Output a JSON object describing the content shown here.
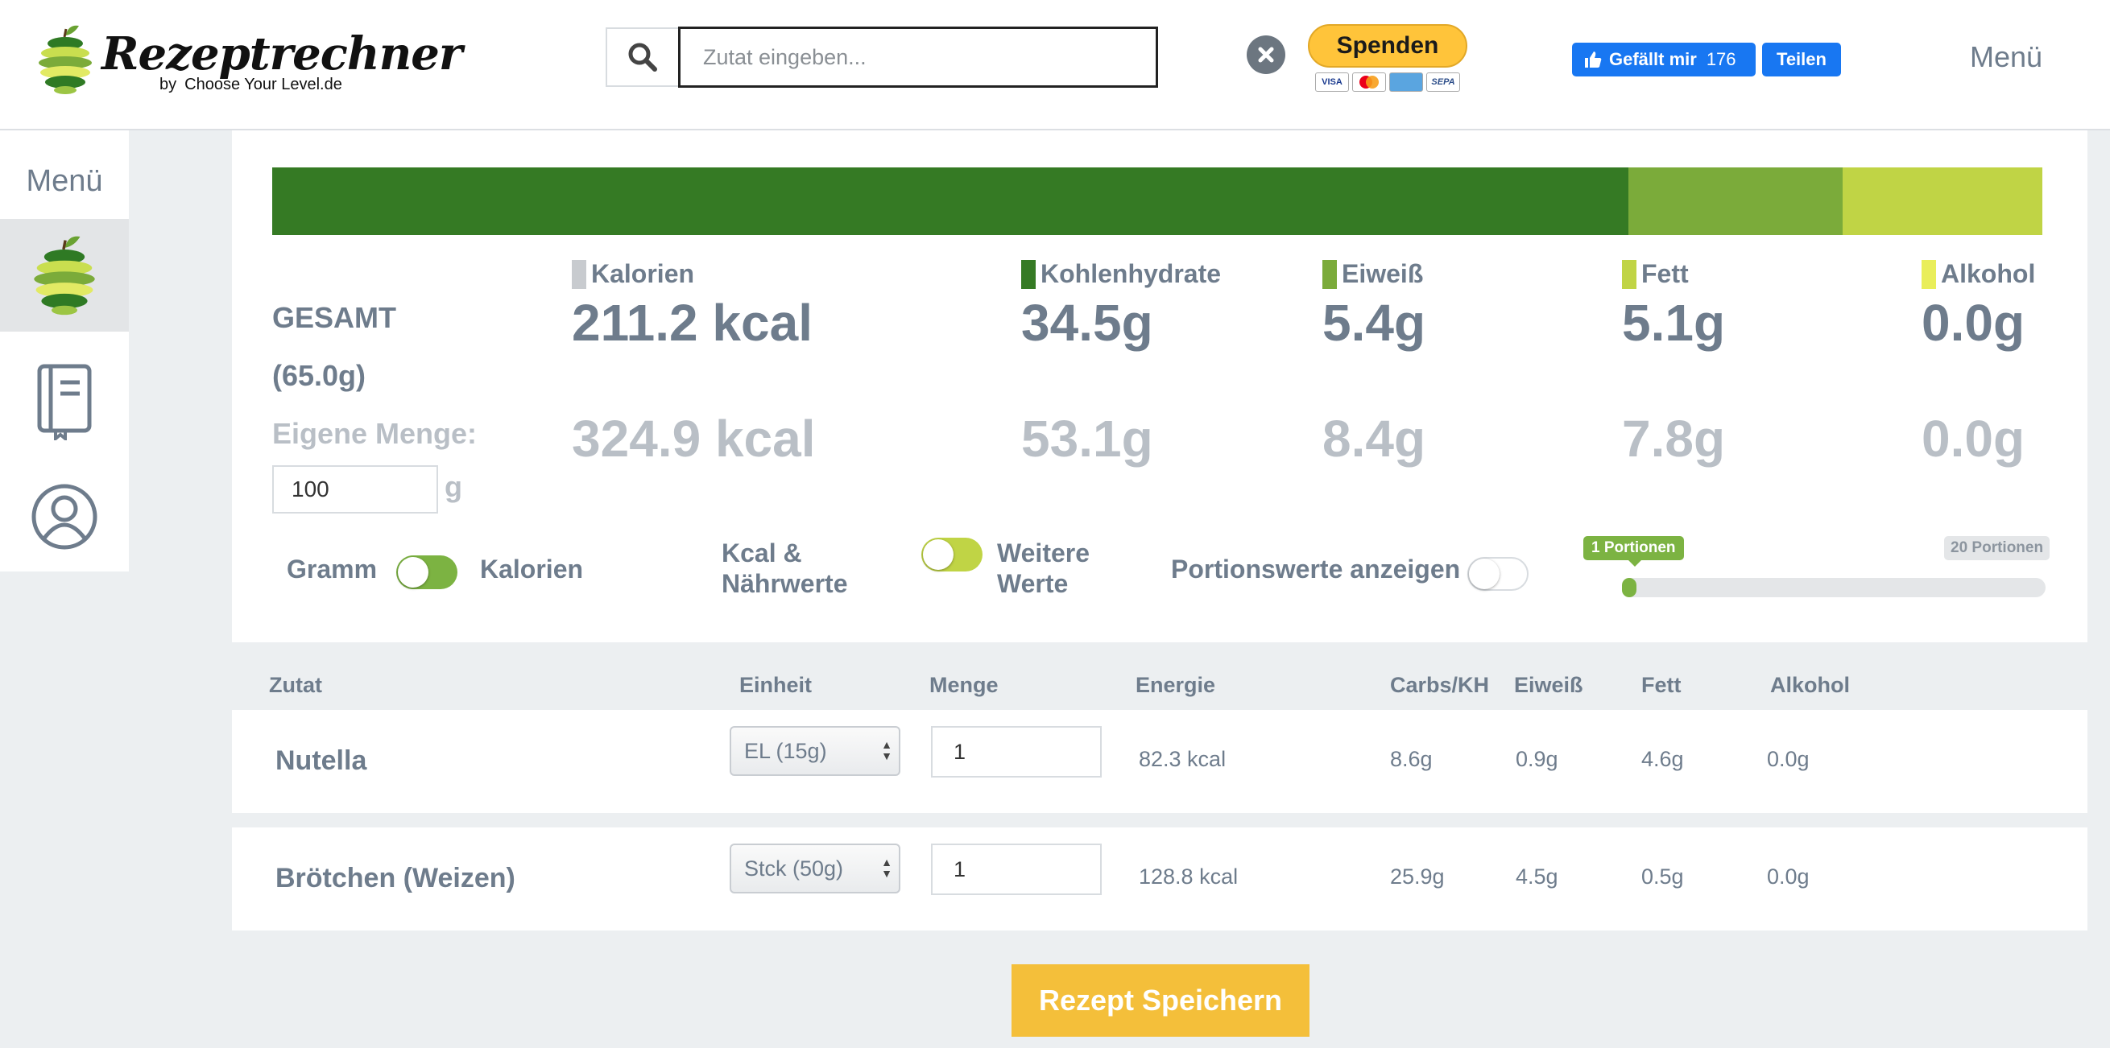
{
  "header": {
    "logo_text": "Rezeptrechner",
    "logo_by": "by",
    "logo_sub": "Choose Your Level.de",
    "search_placeholder": "Zutat eingeben...",
    "donate_label": "Spenden",
    "payment_cards": [
      "VISA",
      "MC",
      "AMEX",
      "SEPA"
    ],
    "fb_like_label": "Gefällt mir",
    "fb_like_count": "176",
    "fb_share_label": "Teilen",
    "menu_label": "Menü"
  },
  "sidebar": {
    "menu_label": "Menü",
    "items": [
      "apple-icon",
      "recipe-book-icon",
      "user-icon"
    ]
  },
  "summary": {
    "macro_bar": {
      "segments": [
        {
          "name": "Kohlenhydrate",
          "fraction": 0.766,
          "color": "#357a24"
        },
        {
          "name": "Eiweiß",
          "fraction": 0.121,
          "color": "#7bab3a"
        },
        {
          "name": "Fett",
          "fraction": 0.113,
          "color": "#c0d445"
        },
        {
          "name": "Alkohol",
          "fraction": 0.0,
          "color": "#e9ee5a"
        }
      ]
    },
    "legend": {
      "kalorien": {
        "label": "Kalorien",
        "color": "#c8cbcf"
      },
      "kohlenhydrate": {
        "label": "Kohlenhydrate",
        "color": "#357a24"
      },
      "eiweiss": {
        "label": "Eiweiß",
        "color": "#7bab3a"
      },
      "fett": {
        "label": "Fett",
        "color": "#c0d445"
      },
      "alkohol": {
        "label": "Alkohol",
        "color": "#e9ee5a"
      }
    },
    "gesamt_label": "GESAMT",
    "gesamt_weight": "(65.0g)",
    "total": {
      "kcal": "211.2 kcal",
      "carbs": "34.5g",
      "protein": "5.4g",
      "fat": "5.1g",
      "alcohol": "0.0g"
    },
    "eigene_menge_label": "Eigene Menge:",
    "eigene_menge_value": "100",
    "eigene_menge_unit": "g",
    "custom": {
      "kcal": "324.9 kcal",
      "carbs": "53.1g",
      "protein": "8.4g",
      "fat": "7.8g",
      "alcohol": "0.0g"
    },
    "toggle_gramm": "Gramm",
    "toggle_kalorien": "Kalorien",
    "toggle_kcal_naehr_1": "Kcal &",
    "toggle_kcal_naehr_2": "Nährwerte",
    "toggle_weitere_1": "Weitere",
    "toggle_weitere_2": "Werte",
    "toggle_portion": "Portionswerte anzeigen",
    "slider_min_label": "1 Portionen",
    "slider_max_label": "20 Portionen"
  },
  "table": {
    "headers": {
      "zutat": "Zutat",
      "einheit": "Einheit",
      "menge": "Menge",
      "energie": "Energie",
      "carbs": "Carbs/KH",
      "eiweiss": "Eiweiß",
      "fett": "Fett",
      "alkohol": "Alkohol"
    },
    "rows": [
      {
        "name": "Nutella",
        "unit": "EL (15g)",
        "qty": "1",
        "energy": "82.3 kcal",
        "carbs": "8.6g",
        "protein": "0.9g",
        "fat": "4.6g",
        "alcohol": "0.0g"
      },
      {
        "name": "Brötchen (Weizen)",
        "unit": "Stck (50g)",
        "qty": "1",
        "energy": "128.8 kcal",
        "carbs": "25.9g",
        "protein": "4.5g",
        "fat": "0.5g",
        "alcohol": "0.0g"
      }
    ]
  },
  "save_button_label": "Rezept Speichern"
}
